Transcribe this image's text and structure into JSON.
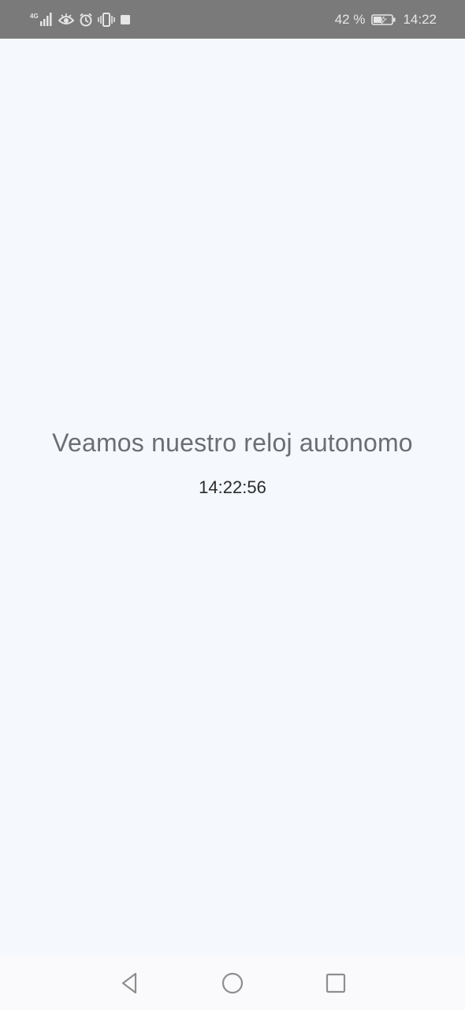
{
  "status_bar": {
    "network": "4G",
    "battery_percent": "42 %",
    "time": "14:22",
    "icons": [
      "signal-icon",
      "eye-comfort-icon",
      "alarm-icon",
      "vibrate-icon",
      "notification-square-icon",
      "battery-charging-icon"
    ]
  },
  "main": {
    "title": "Veamos nuestro reloj autonomo",
    "clock": "14:22:56"
  },
  "nav_bar": {
    "buttons": [
      "back-icon",
      "home-icon",
      "recents-icon"
    ]
  },
  "colors": {
    "status_bar_bg": "#7a7a7a",
    "page_bg": "#f5f8fc",
    "title_text": "#6b6f73",
    "clock_text": "#2b2b2b"
  }
}
